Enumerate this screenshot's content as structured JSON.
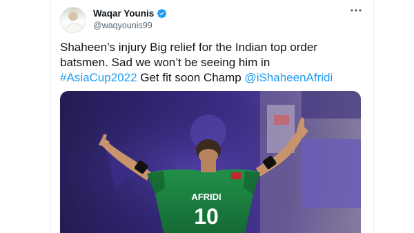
{
  "tweet": {
    "author": {
      "display_name": "Waqar Younis",
      "handle": "@waqyounis99",
      "verified": true
    },
    "text": {
      "line1": "Shaheen’s injury Big relief for the Indian top order",
      "line2": "batsmen. Sad we won’t be seeing him in",
      "hashtag": "#AsiaCup2022",
      "middle": " Get fit soon Champ ",
      "mention": "@iShaheenAfridi"
    },
    "media": {
      "jersey_name": "AFRIDI",
      "jersey_number": "10"
    }
  },
  "icons": {
    "more": "more-horizontal-icon",
    "verified": "verified-badge-icon"
  },
  "colors": {
    "link": "#1d9bf0",
    "text": "#0f1419",
    "secondary": "#536471",
    "jersey": "#1c7a3d"
  }
}
